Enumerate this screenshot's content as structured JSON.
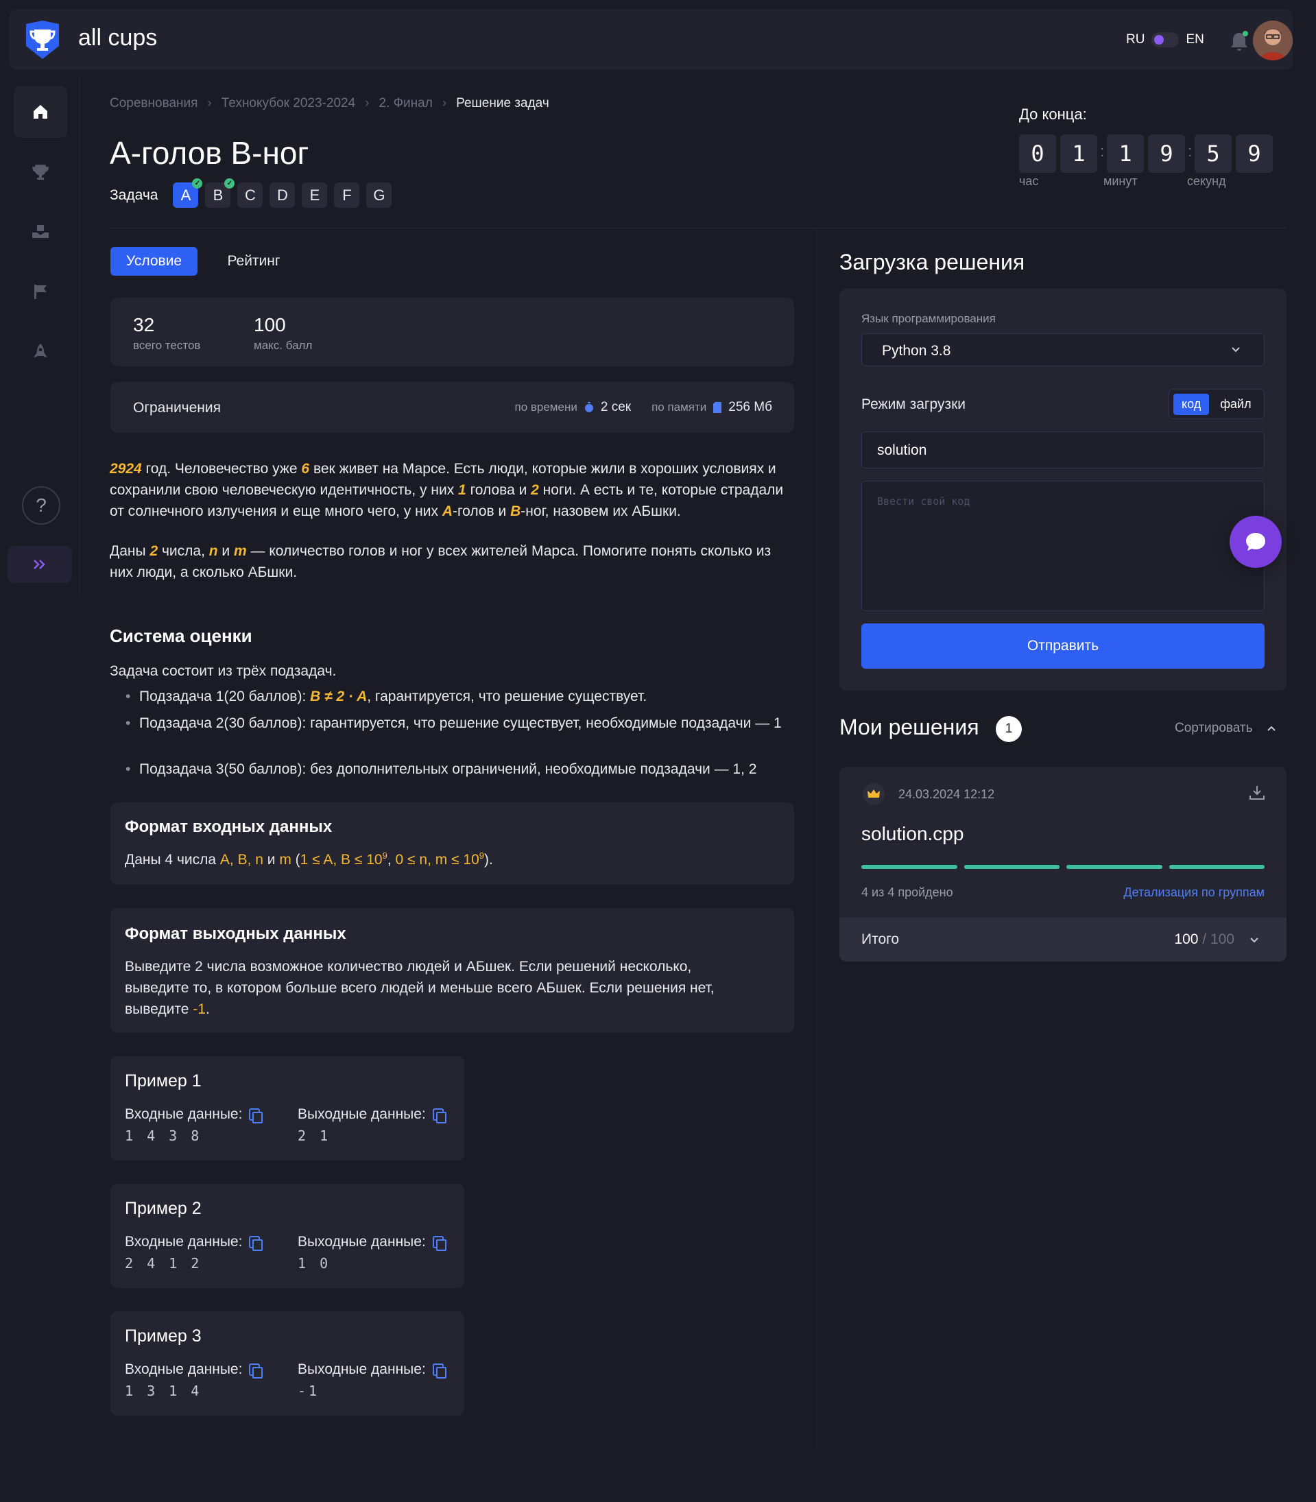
{
  "header": {
    "brand": "all cups",
    "lang_left": "RU",
    "lang_right": "EN",
    "accent": "#2f60f4",
    "toggle_color": "#8b5cf6"
  },
  "sidebar": {
    "items": [
      {
        "icon": "home-icon",
        "active": true
      },
      {
        "icon": "trophy-icon"
      },
      {
        "icon": "box-hand-icon"
      },
      {
        "icon": "flag-icon"
      },
      {
        "icon": "rocket-icon"
      }
    ],
    "help_label": "?",
    "expand_label": "»"
  },
  "breadcrumb": [
    "Соревнования",
    "Технокубок 2023-2024",
    "2. Финал",
    "Решение задач"
  ],
  "problem": {
    "title": "А-голов В-ног",
    "task_label": "Задача",
    "tasks": [
      {
        "letter": "A",
        "active": true,
        "solved": true
      },
      {
        "letter": "B",
        "solved": true
      },
      {
        "letter": "C"
      },
      {
        "letter": "D"
      },
      {
        "letter": "E"
      },
      {
        "letter": "F"
      },
      {
        "letter": "G"
      }
    ]
  },
  "timer": {
    "label": "До конца:",
    "hours": [
      "0",
      "1"
    ],
    "minutes": [
      "1",
      "9"
    ],
    "seconds": [
      "5",
      "9"
    ],
    "unit_hours": "час",
    "unit_minutes": "минут",
    "unit_seconds": "секунд"
  },
  "tabs": [
    "Условие",
    "Рейтинг"
  ],
  "stats": {
    "tests": "32",
    "tests_label": "всего тестов",
    "max": "100",
    "max_label": "макс. балл"
  },
  "limits": {
    "title": "Ограничения",
    "time_label": "по времени",
    "time_value": "2 сек",
    "memory_label": "по памяти",
    "memory_value": "256 Мб"
  },
  "statement": {
    "p1": {
      "year": "2924",
      "t1": " год. Человечество уже ",
      "n6": "6",
      "t2": " век живет на Марсе. Есть люди, которые жили в хороших условиях и сохранили свою человеческую идентичность, у них ",
      "n1": "1",
      "t3": " голова и ",
      "n2": "2",
      "t4": " ноги. А есть и те, которые страдали от солнечного излучения и еще много чего, у них ",
      "a": "A",
      "t5": "-голов и ",
      "b": "B",
      "t6": "-ног, назовем их АБшки."
    },
    "p2": {
      "t1": "Даны ",
      "n2": "2",
      "t2": " числа, ",
      "n": "n",
      "t3": " и ",
      "m": "m",
      "t4": " — количество голов и ног у всех жителей Марса. Помогите понять сколько из них люди, а сколько АБшки."
    }
  },
  "grading": {
    "title": "Система оценки",
    "intro": "Задача состоит из трёх подзадач.",
    "sub1_pre": "Подзадача 1(20 баллов): ",
    "sub1_formula": "B ≠ 2 · A",
    "sub1_post": ", гарантируется, что решение существует.",
    "sub2": "Подзадача 2(30 баллов): гарантируется, что решение существует, необходимые подзадачи — 1",
    "sub3": "Подзадача 3(50 баллов): без дополнительных ограничений, необходимые подзадачи — 1, 2"
  },
  "input_format": {
    "title": "Формат входных данных",
    "t1": "Даны 4 числа ",
    "vars": "A, B, n",
    "t2": " и ",
    "m": "m",
    "t3": " (",
    "c1": "1 ≤ A, B ≤ 10",
    "exp": "9",
    "t4": ", ",
    "c2": "0 ≤ n, m ≤ 10",
    "t5": ")."
  },
  "output_format": {
    "title": "Формат выходных данных",
    "text": "Выведите 2 числа возможное количество людей и АБшек. Если решений несколько, выведите то, в котором больше всего людей и меньше всего АБшек. Если решения нет, выведите ",
    "minus": "-1",
    "end": "."
  },
  "examples": [
    {
      "title": "Пример 1",
      "in_label": "Входные данные:",
      "out_label": "Выходные данные:",
      "input": "1 4 3 8",
      "output": "2 1"
    },
    {
      "title": "Пример 2",
      "in_label": "Входные данные:",
      "out_label": "Выходные данные:",
      "input": "2 4 1 2",
      "output": "1 0"
    },
    {
      "title": "Пример 3",
      "in_label": "Входные данные:",
      "out_label": "Выходные данные:",
      "input": "1 3 1 4",
      "output": "-1"
    }
  ],
  "upload": {
    "title": "Загрузка решения",
    "lang_label": "Язык программирования",
    "lang_value": "Python 3.8",
    "mode_label": "Режим загрузки",
    "mode_code": "код",
    "mode_file": "файл",
    "filename": "solution",
    "code_placeholder": "Ввести свой код",
    "submit": "Отправить"
  },
  "solutions": {
    "title": "Мои решения",
    "count": "1",
    "sort_label": "Сортировать",
    "item": {
      "date": "24.03.2024 12:12",
      "file": "solution.cpp",
      "passed": "4 из 4 пройдено",
      "details": "Детализация по группам",
      "total_label": "Итого",
      "score": "100",
      "max": "/ 100",
      "groups_passed": 4,
      "groups_total": 4
    }
  }
}
